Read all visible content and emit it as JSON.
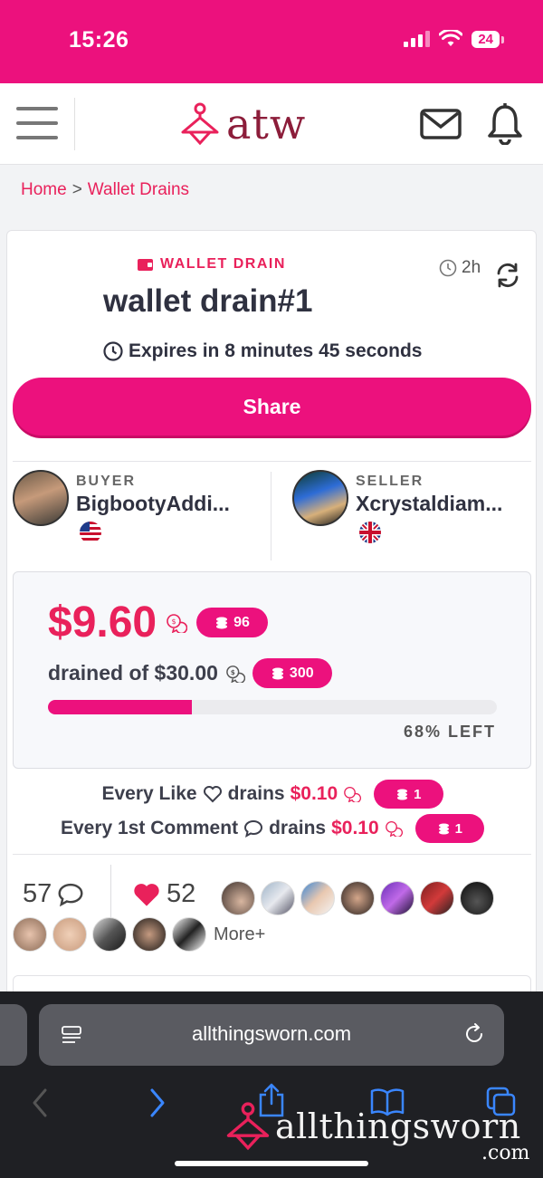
{
  "status_bar": {
    "time": "15:26",
    "battery": "24"
  },
  "header": {
    "logo_text": "atw"
  },
  "breadcrumb": {
    "home": "Home",
    "separator": ">",
    "current": "Wallet Drains"
  },
  "listing": {
    "type_label": "WALLET DRAIN",
    "time_ago": "2h",
    "title": "wallet drain#1",
    "expires": "Expires in 8 minutes 45 seconds",
    "share_label": "Share"
  },
  "buyer": {
    "role": "BUYER",
    "name": "BigbootyAddi...",
    "flag": "us"
  },
  "seller": {
    "role": "SELLER",
    "name": "Xcrystaldiam...",
    "flag": "uk"
  },
  "drain": {
    "amount": "$9.60",
    "amount_coins": "96",
    "drained_text": "drained of $30.00",
    "total_coins": "300",
    "progress_fraction": 0.32,
    "left_label": "68% LEFT"
  },
  "rules": [
    {
      "prefix": "Every Like",
      "icon": "heart-outline-icon",
      "drains": "drains",
      "price": "$0.10",
      "coins": "1"
    },
    {
      "prefix": "Every 1st Comment",
      "icon": "comment-outline-icon",
      "drains": "drains",
      "price": "$0.10",
      "coins": "1"
    }
  ],
  "engagement": {
    "comments": "57",
    "likes": "52",
    "more_label": "More+"
  },
  "browser": {
    "url": "allthingsworn.com"
  },
  "watermark": {
    "text": "allthingsworn",
    "suffix": ".com"
  },
  "colors": {
    "brand_pink": "#ec117d",
    "accent_red": "#e9215b",
    "logo_maroon": "#8c1d3a"
  }
}
